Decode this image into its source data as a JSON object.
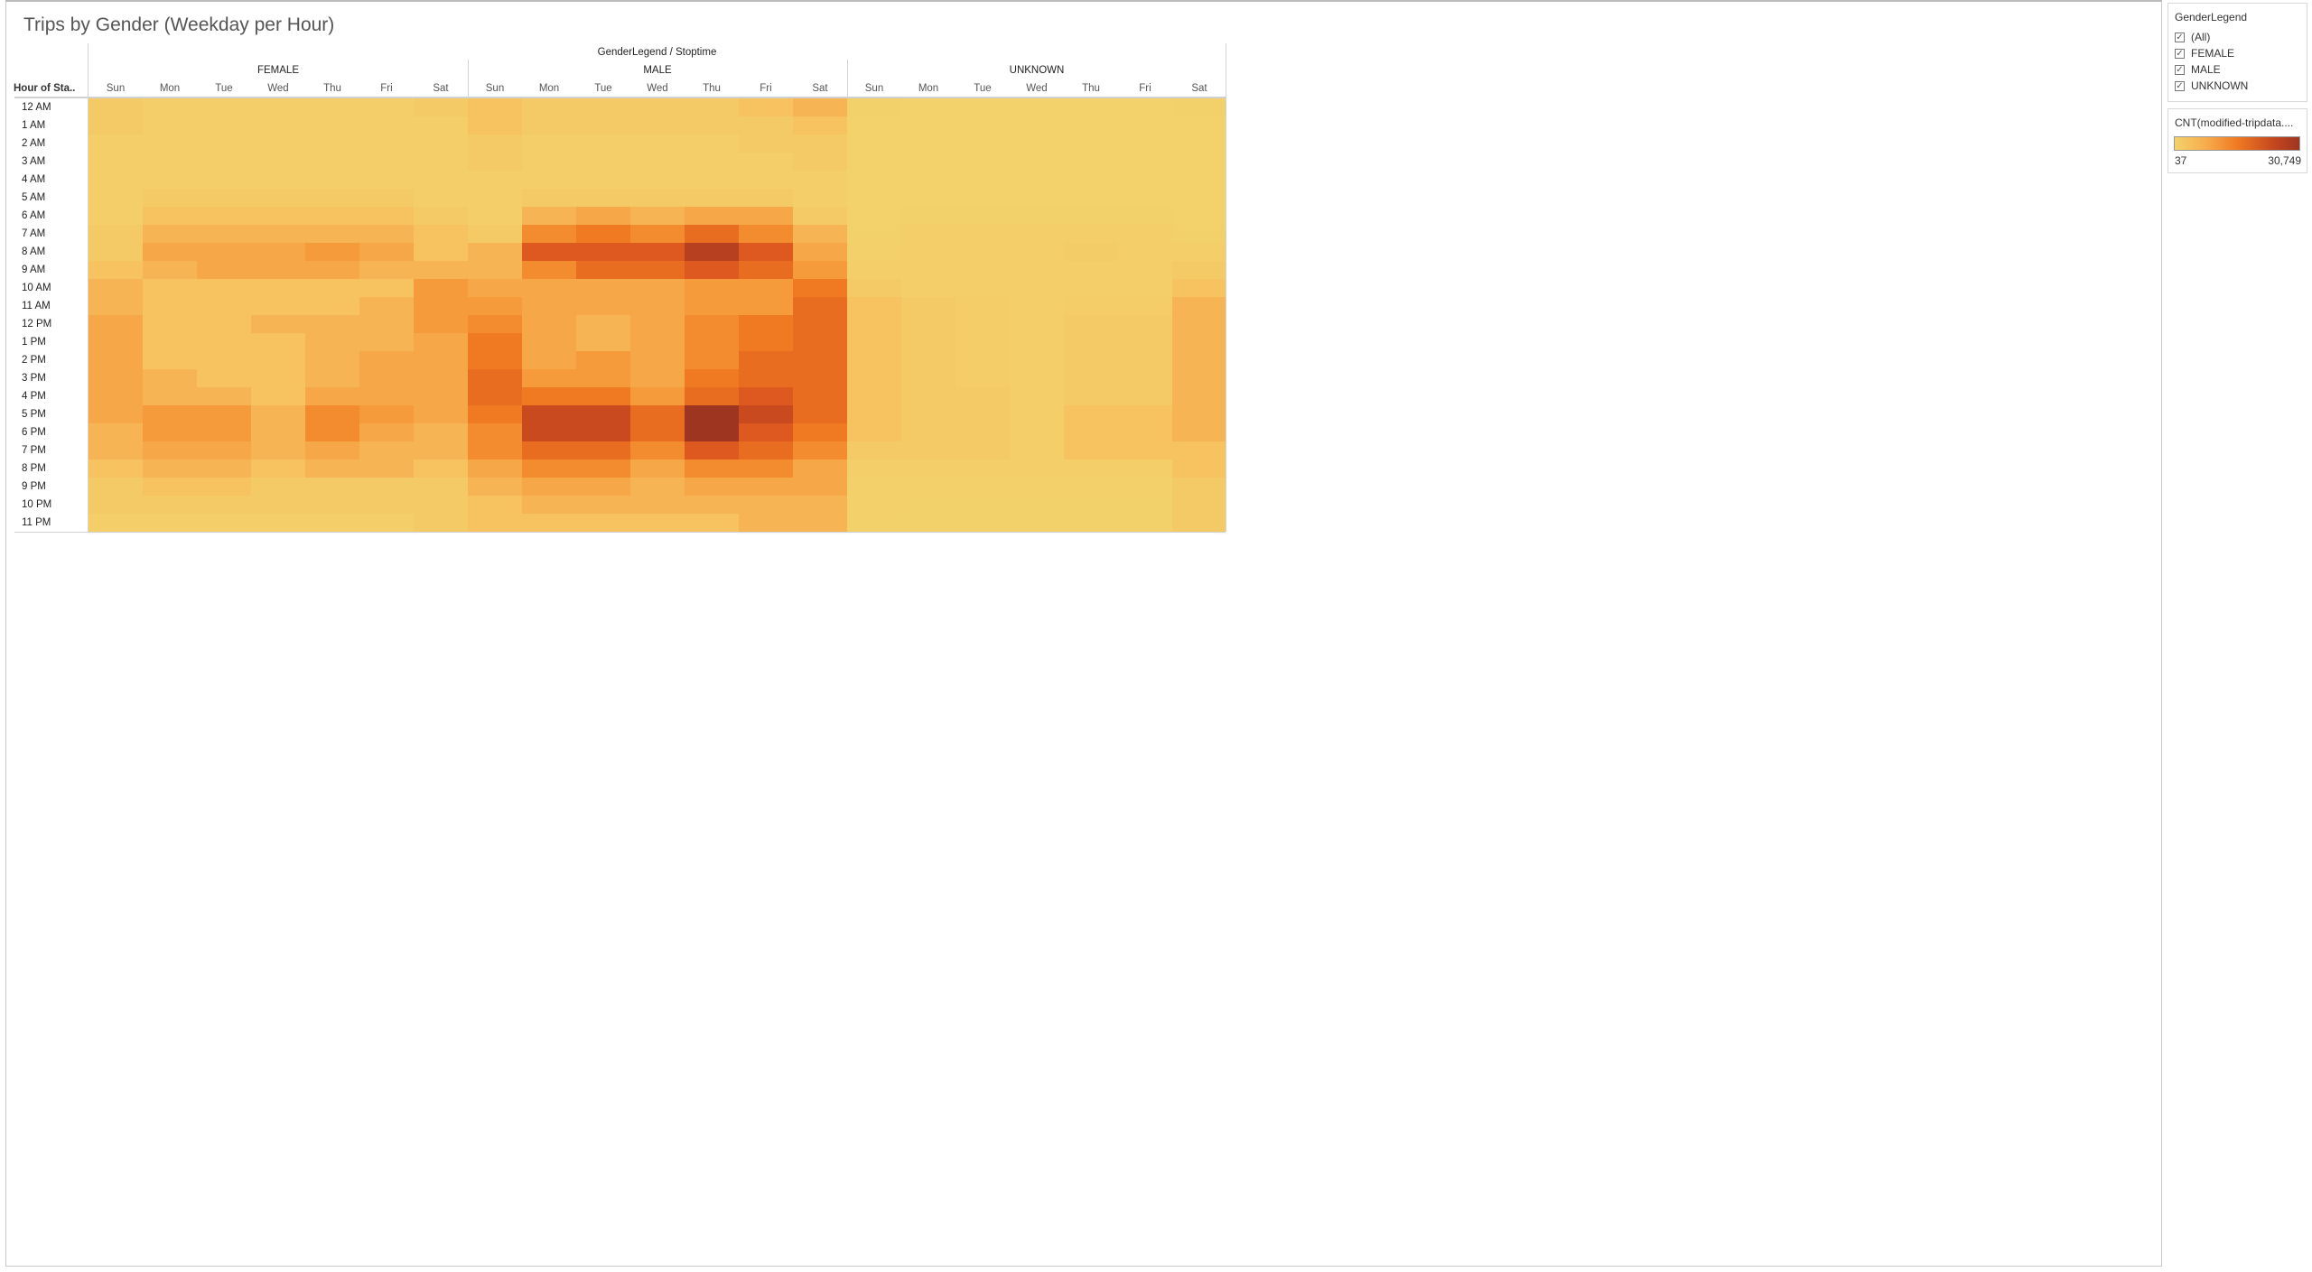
{
  "title": "Trips by Gender (Weekday per Hour)",
  "chart_data": {
    "type": "heatmap",
    "title": "Trips by Gender (Weekday per Hour)",
    "column_header": "GenderLegend / Stoptime",
    "row_header": "Hour of Sta..",
    "genders": [
      "FEMALE",
      "MALE",
      "UNKNOWN"
    ],
    "days": [
      "Sun",
      "Mon",
      "Tue",
      "Wed",
      "Thu",
      "Fri",
      "Sat"
    ],
    "hours": [
      "12 AM",
      "1 AM",
      "2 AM",
      "3 AM",
      "4 AM",
      "5 AM",
      "6 AM",
      "7 AM",
      "8 AM",
      "9 AM",
      "10 AM",
      "11 AM",
      "12 PM",
      "1 PM",
      "2 PM",
      "3 PM",
      "4 PM",
      "5 PM",
      "6 PM",
      "7 PM",
      "8 PM",
      "9 PM",
      "10 PM",
      "11 PM"
    ],
    "color_measure": "CNT(modified-tripdata....",
    "color_range": [
      37,
      30749
    ],
    "values": {
      "FEMALE": [
        [
          1500,
          600,
          600,
          600,
          600,
          600,
          1500
        ],
        [
          1500,
          600,
          600,
          600,
          600,
          600,
          600
        ],
        [
          600,
          600,
          600,
          600,
          600,
          600,
          600
        ],
        [
          600,
          600,
          600,
          600,
          600,
          600,
          600
        ],
        [
          600,
          600,
          600,
          600,
          600,
          600,
          600
        ],
        [
          600,
          1500,
          1500,
          1500,
          1500,
          1500,
          600
        ],
        [
          600,
          3000,
          3000,
          3000,
          3000,
          3000,
          1500
        ],
        [
          1500,
          5000,
          5000,
          5000,
          5000,
          5000,
          3000
        ],
        [
          1500,
          7000,
          7000,
          7000,
          9000,
          7000,
          3000
        ],
        [
          3000,
          5000,
          7000,
          7000,
          7000,
          5000,
          5000
        ],
        [
          5000,
          3000,
          3000,
          3000,
          3000,
          3000,
          9000
        ],
        [
          5000,
          3000,
          3000,
          3000,
          3000,
          5000,
          9000
        ],
        [
          7000,
          3000,
          3000,
          5000,
          5000,
          5000,
          9000
        ],
        [
          7000,
          3000,
          3000,
          3000,
          5000,
          5000,
          7000
        ],
        [
          7000,
          3000,
          3000,
          3000,
          5000,
          7000,
          7000
        ],
        [
          7000,
          5000,
          3000,
          3000,
          5000,
          7000,
          7000
        ],
        [
          7000,
          5000,
          5000,
          3000,
          7000,
          7000,
          7000
        ],
        [
          7000,
          9000,
          9000,
          5000,
          11000,
          9000,
          7000
        ],
        [
          5000,
          9000,
          9000,
          5000,
          11000,
          7000,
          5000
        ],
        [
          5000,
          7000,
          7000,
          5000,
          7000,
          5000,
          5000
        ],
        [
          3000,
          5000,
          5000,
          3000,
          5000,
          5000,
          3000
        ],
        [
          1500,
          3000,
          3000,
          1500,
          1500,
          1500,
          1500
        ],
        [
          1500,
          1500,
          1500,
          1500,
          1500,
          1500,
          1500
        ],
        [
          600,
          600,
          600,
          600,
          600,
          600,
          1500
        ]
      ],
      "MALE": [
        [
          3000,
          1500,
          1500,
          1500,
          1500,
          3000,
          5000
        ],
        [
          3000,
          1500,
          1500,
          1500,
          1500,
          1500,
          3000
        ],
        [
          1500,
          600,
          600,
          600,
          600,
          1500,
          1500
        ],
        [
          1500,
          600,
          600,
          600,
          600,
          600,
          1500
        ],
        [
          600,
          600,
          600,
          600,
          600,
          600,
          600
        ],
        [
          600,
          1500,
          1500,
          1500,
          1500,
          1500,
          600
        ],
        [
          600,
          5000,
          7000,
          5000,
          7000,
          7000,
          1500
        ],
        [
          1500,
          11000,
          13000,
          11000,
          15000,
          11000,
          5000
        ],
        [
          5000,
          18000,
          18000,
          18000,
          26000,
          18000,
          7000
        ],
        [
          5000,
          11000,
          15000,
          15000,
          18000,
          15000,
          9000
        ],
        [
          7000,
          7000,
          7000,
          7000,
          9000,
          9000,
          13000
        ],
        [
          9000,
          7000,
          7000,
          7000,
          9000,
          9000,
          15000
        ],
        [
          11000,
          7000,
          5000,
          7000,
          11000,
          13000,
          15000
        ],
        [
          13000,
          7000,
          5000,
          7000,
          11000,
          13000,
          15000
        ],
        [
          13000,
          7000,
          9000,
          7000,
          11000,
          15000,
          15000
        ],
        [
          15000,
          9000,
          9000,
          7000,
          13000,
          15000,
          15000
        ],
        [
          15000,
          13000,
          13000,
          9000,
          15000,
          18000,
          15000
        ],
        [
          13000,
          22000,
          22000,
          15000,
          30749,
          22000,
          15000
        ],
        [
          11000,
          22000,
          22000,
          15000,
          30749,
          18000,
          13000
        ],
        [
          11000,
          15000,
          15000,
          11000,
          18000,
          15000,
          11000
        ],
        [
          7000,
          11000,
          11000,
          7000,
          11000,
          11000,
          7000
        ],
        [
          5000,
          7000,
          7000,
          5000,
          7000,
          7000,
          7000
        ],
        [
          3000,
          5000,
          5000,
          5000,
          5000,
          5000,
          5000
        ],
        [
          3000,
          3000,
          3000,
          3000,
          3000,
          5000,
          5000
        ]
      ],
      "UNKNOWN": [
        [
          200,
          100,
          100,
          100,
          100,
          100,
          200
        ],
        [
          150,
          80,
          80,
          80,
          80,
          80,
          150
        ],
        [
          100,
          60,
          60,
          60,
          60,
          60,
          100
        ],
        [
          80,
          50,
          50,
          50,
          50,
          50,
          80
        ],
        [
          60,
          37,
          40,
          40,
          40,
          40,
          60
        ],
        [
          80,
          100,
          100,
          100,
          100,
          100,
          80
        ],
        [
          150,
          300,
          300,
          300,
          300,
          300,
          150
        ],
        [
          300,
          600,
          600,
          600,
          800,
          600,
          300
        ],
        [
          500,
          900,
          900,
          900,
          1200,
          900,
          600
        ],
        [
          700,
          600,
          700,
          700,
          800,
          700,
          1500
        ],
        [
          1500,
          700,
          700,
          700,
          800,
          800,
          3000
        ],
        [
          3000,
          1500,
          1000,
          900,
          1000,
          1000,
          5000
        ],
        [
          3000,
          1500,
          1000,
          900,
          1500,
          1500,
          5000
        ],
        [
          3000,
          1500,
          1000,
          700,
          1500,
          1500,
          5000
        ],
        [
          3000,
          1500,
          1000,
          700,
          1500,
          1500,
          5000
        ],
        [
          3000,
          1500,
          1000,
          700,
          1500,
          1500,
          5000
        ],
        [
          3000,
          1500,
          1500,
          700,
          1500,
          1500,
          5000
        ],
        [
          3000,
          1500,
          1500,
          700,
          3000,
          3000,
          5000
        ],
        [
          3000,
          1500,
          1500,
          700,
          3000,
          3000,
          5000
        ],
        [
          1500,
          1500,
          1500,
          700,
          3000,
          3000,
          3000
        ],
        [
          700,
          600,
          600,
          600,
          600,
          600,
          3000
        ],
        [
          500,
          400,
          400,
          400,
          400,
          400,
          1500
        ],
        [
          400,
          300,
          300,
          300,
          300,
          300,
          1500
        ],
        [
          300,
          200,
          200,
          200,
          200,
          200,
          1500
        ]
      ]
    }
  },
  "filter": {
    "title": "GenderLegend",
    "items": [
      {
        "label": "(All)",
        "checked": true
      },
      {
        "label": "FEMALE",
        "checked": true
      },
      {
        "label": "MALE",
        "checked": true
      },
      {
        "label": "UNKNOWN",
        "checked": true
      }
    ]
  },
  "color_legend": {
    "title": "CNT(modified-tripdata....",
    "min_label": "37",
    "max_label": "30,749"
  }
}
